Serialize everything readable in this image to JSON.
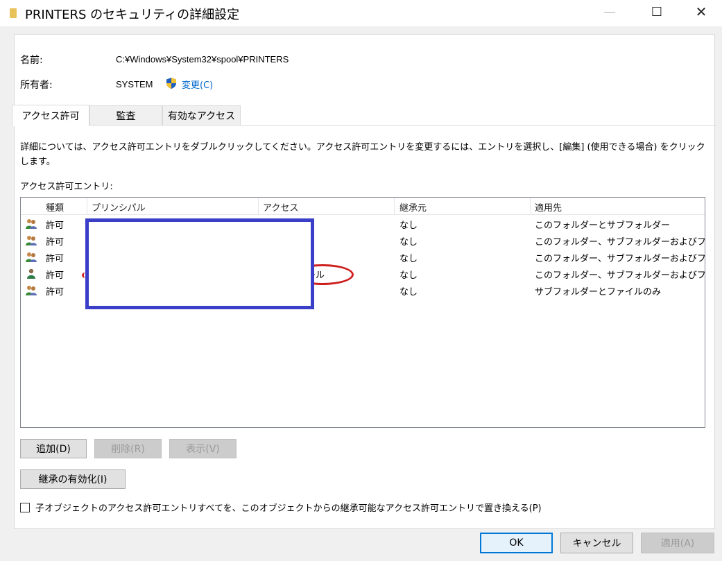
{
  "window": {
    "title": "PRINTERS のセキュリティの詳細設定",
    "minimize": "—",
    "maximize": "☐",
    "close": "✕"
  },
  "info": {
    "name_label": "名前:",
    "name_value": "C:¥Windows¥System32¥spool¥PRINTERS",
    "owner_label": "所有者:",
    "owner_value": "SYSTEM",
    "change_link": "変更(C)"
  },
  "tabs": [
    {
      "label": "アクセス許可",
      "active": true
    },
    {
      "label": "監査",
      "active": false
    },
    {
      "label": "有効なアクセス",
      "active": false
    }
  ],
  "description": "詳細については、アクセス許可エントリをダブルクリックしてください。アクセス許可エントリを変更するには、エントリを選択し、[編集] (使用できる場合) をクリックします。",
  "entries_label": "アクセス許可エントリ:",
  "table": {
    "columns": [
      "種類",
      "プリンシパル",
      "アクセス",
      "継承元",
      "適用先"
    ],
    "rows": [
      {
        "icon": "group-users-icon",
        "type": "許可",
        "inherited": "なし",
        "applies_to": "このフォルダーとサブフォルダー"
      },
      {
        "icon": "group-users-icon",
        "type": "許可",
        "inherited": "なし",
        "applies_to": "このフォルダー、サブフォルダーおよびファ..."
      },
      {
        "icon": "group-users-icon",
        "type": "許可",
        "inherited": "なし",
        "applies_to": "このフォルダー、サブフォルダーおよびファ..."
      },
      {
        "icon": "single-user-icon",
        "type": "許可",
        "inherited": "なし",
        "applies_to": "このフォルダー、サブフォルダーおよびファ...",
        "access_peek": "ール"
      },
      {
        "icon": "group-users-icon",
        "type": "許可",
        "inherited": "なし",
        "applies_to": "サブフォルダーとファイルのみ"
      }
    ]
  },
  "buttons": {
    "add": "追加(D)",
    "remove": "削除(R)",
    "view": "表示(V)",
    "enable_inheritance": "継承の有効化(I)",
    "ok": "OK",
    "cancel": "キャンセル",
    "apply": "適用(A)"
  },
  "replace_checkbox_label": "子オブジェクトのアクセス許可エントリすべてを、このオブジェクトからの継承可能なアクセス許可エントリで置き換える(P)",
  "colors": {
    "accent": "#0078d7",
    "link": "#0066cc",
    "redaction_border": "#3b3fc7",
    "annotation_red": "#cf2020"
  }
}
